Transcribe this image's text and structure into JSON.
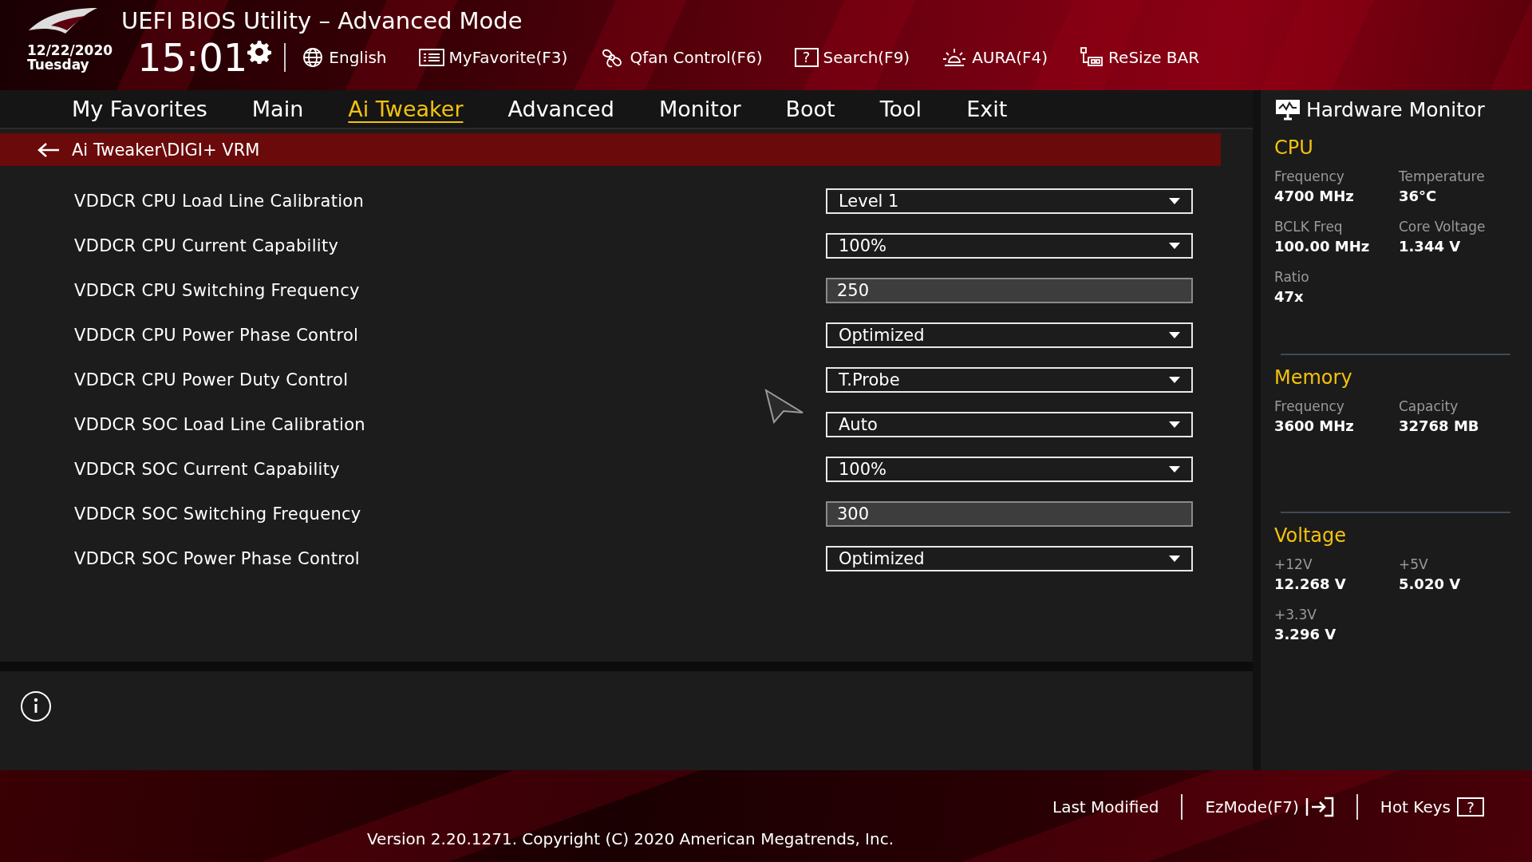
{
  "header": {
    "title": "UEFI BIOS Utility – Advanced Mode",
    "date": "12/22/2020",
    "day": "Tuesday",
    "time": "15:01",
    "toolbar": [
      {
        "kind": "language",
        "label": "English"
      },
      {
        "kind": "favorite",
        "label": "MyFavorite(F3)"
      },
      {
        "kind": "fan",
        "label": "Qfan Control(F6)"
      },
      {
        "kind": "search",
        "glyph": "?",
        "label": "Search(F9)"
      },
      {
        "kind": "aura",
        "label": "AURA(F4)"
      },
      {
        "kind": "resize",
        "label": "ReSize BAR"
      }
    ]
  },
  "tabs": [
    {
      "label": "My Favorites",
      "selected": false
    },
    {
      "label": "Main",
      "selected": false
    },
    {
      "label": "Ai Tweaker",
      "selected": true
    },
    {
      "label": "Advanced",
      "selected": false
    },
    {
      "label": "Monitor",
      "selected": false
    },
    {
      "label": "Boot",
      "selected": false
    },
    {
      "label": "Tool",
      "selected": false
    },
    {
      "label": "Exit",
      "selected": false
    }
  ],
  "breadcrumb": "Ai Tweaker\\DIGI+ VRM",
  "settings": [
    {
      "label": "VDDCR CPU Load Line Calibration",
      "kind": "dropdown",
      "value": "Level 1"
    },
    {
      "label": "VDDCR CPU Current Capability",
      "kind": "dropdown",
      "value": "100%"
    },
    {
      "label": "VDDCR CPU Switching Frequency",
      "kind": "number",
      "value": "250"
    },
    {
      "label": "VDDCR CPU Power Phase Control",
      "kind": "dropdown",
      "value": "Optimized"
    },
    {
      "label": "VDDCR CPU Power Duty Control",
      "kind": "dropdown",
      "value": "T.Probe"
    },
    {
      "label": "VDDCR SOC Load Line Calibration",
      "kind": "dropdown",
      "value": "Auto"
    },
    {
      "label": "VDDCR SOC Current Capability",
      "kind": "dropdown",
      "value": "100%"
    },
    {
      "label": "VDDCR SOC Switching Frequency",
      "kind": "number",
      "value": "300"
    },
    {
      "label": "VDDCR SOC Power Phase Control",
      "kind": "dropdown",
      "value": "Optimized"
    }
  ],
  "hardware_monitor": {
    "title": "Hardware Monitor",
    "sections": [
      {
        "title": "CPU",
        "items": [
          {
            "label": "Frequency",
            "value": "4700 MHz"
          },
          {
            "label": "Temperature",
            "value": "36°C"
          },
          {
            "label": "BCLK Freq",
            "value": "100.00 MHz"
          },
          {
            "label": "Core Voltage",
            "value": "1.344 V"
          },
          {
            "label": "Ratio",
            "value": "47x"
          }
        ]
      },
      {
        "title": "Memory",
        "items": [
          {
            "label": "Frequency",
            "value": "3600 MHz"
          },
          {
            "label": "Capacity",
            "value": "32768 MB"
          }
        ]
      },
      {
        "title": "Voltage",
        "items": [
          {
            "label": "+12V",
            "value": "12.268 V"
          },
          {
            "label": "+5V",
            "value": "5.020 V"
          },
          {
            "label": "+3.3V",
            "value": "3.296 V"
          }
        ]
      }
    ]
  },
  "footer": {
    "last_modified": "Last Modified",
    "ez_mode": "EzMode(F7)",
    "hot_keys": "Hot Keys",
    "hot_keys_glyph": "?",
    "version": "Version 2.20.1271. Copyright (C) 2020 American Megatrends, Inc."
  }
}
